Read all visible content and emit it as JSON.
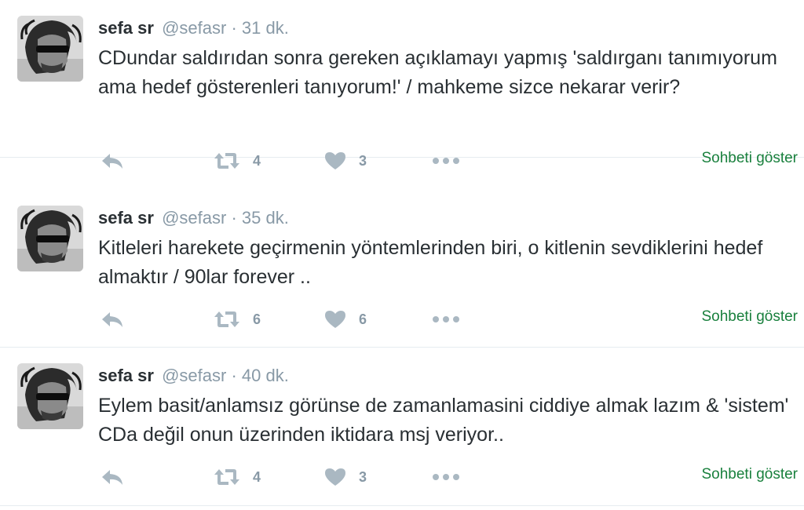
{
  "tweets": [
    {
      "fullname": "sefa sr",
      "username": "@sefasr",
      "separator": "·",
      "time": "31 dk.",
      "text": "CDundar saldırıdan sonra gereken açıklamayı yapmış 'saldırganı tanımıyorum ama hedef gösterenleri tanıyorum!' / mahkeme sizce nekarar verir?",
      "retweets": "4",
      "likes": "3",
      "conversation_label": "Sohbeti göster"
    },
    {
      "fullname": "sefa sr",
      "username": "@sefasr",
      "separator": "·",
      "time": "35 dk.",
      "text": "Kitleleri harekete geçirmenin yöntemlerinden biri, o kitlenin sevdiklerini hedef almaktır / 90lar forever ..",
      "retweets": "6",
      "likes": "6",
      "conversation_label": "Sohbeti göster"
    },
    {
      "fullname": "sefa sr",
      "username": "@sefasr",
      "separator": "·",
      "time": "40 dk.",
      "text": "Eylem basit/anlamsız görünse de zamanlamasini ciddiye almak lazım & 'sistem' CDa değil onun üzerinden iktidara msj veriyor..",
      "retweets": "4",
      "likes": "3",
      "conversation_label": "Sohbeti göster"
    }
  ],
  "icons": [
    "reply-icon",
    "retweet-icon",
    "heart-icon",
    "more-icon"
  ],
  "colors": {
    "text": "#292f33",
    "muted": "#8899a6",
    "icon": "#aab8c2",
    "conversation_link": "#19803d",
    "divider": "#e6ecf0"
  }
}
